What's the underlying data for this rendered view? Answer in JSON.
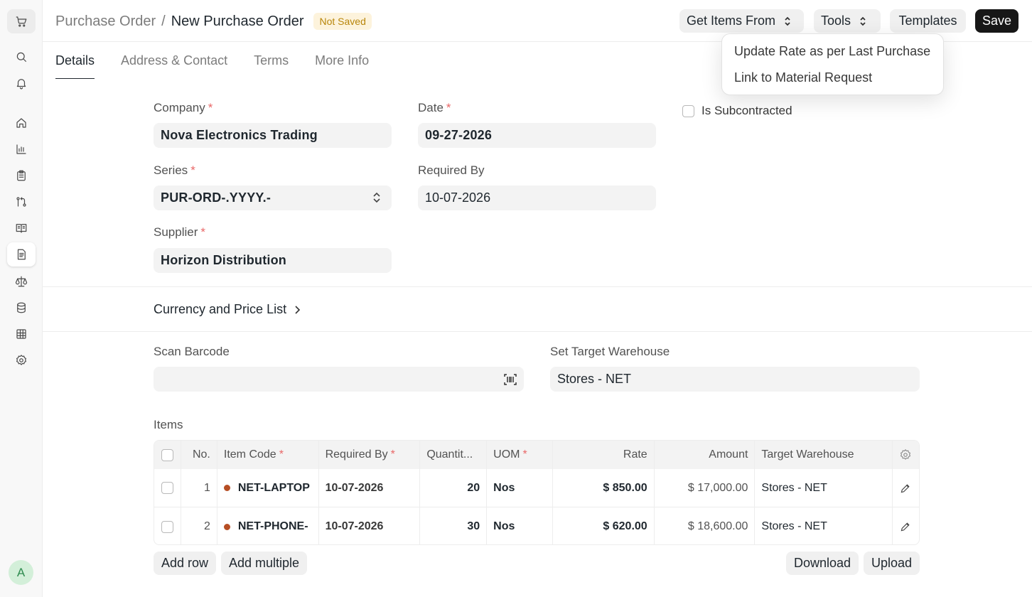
{
  "sidebar": {
    "icons": [
      "cart-icon",
      "search-icon",
      "bell-icon",
      "home-icon",
      "chart-icon",
      "clipboard-icon",
      "flow-icon",
      "book-icon",
      "document-icon",
      "scale-icon",
      "database-icon",
      "table-icon",
      "gear-icon"
    ],
    "avatar": "A"
  },
  "header": {
    "breadcrumb_parent": "Purchase Order",
    "breadcrumb_sep": "/",
    "title": "New Purchase Order",
    "status": "Not Saved",
    "get_items": "Get Items From",
    "tools": "Tools",
    "templates": "Templates",
    "save": "Save"
  },
  "tools_menu": {
    "items": [
      "Update Rate as per Last Purchase",
      "Link to Material Request"
    ]
  },
  "tabs": [
    "Details",
    "Address & Contact",
    "Terms",
    "More Info"
  ],
  "form": {
    "company_label": "Company",
    "company_value": "Nova Electronics Trading",
    "date_label": "Date",
    "date_value": "09-27-2026",
    "subcontracted_label": "Is Subcontracted",
    "series_label": "Series",
    "series_value": "PUR-ORD-.YYYY.-",
    "required_by_label": "Required By",
    "required_by_value": "10-07-2026",
    "supplier_label": "Supplier",
    "supplier_value": "Horizon Distribution",
    "required_mark": "*"
  },
  "currency_section": "Currency and Price List",
  "scan": {
    "barcode_label": "Scan Barcode",
    "barcode_value": "",
    "warehouse_label": "Set Target Warehouse",
    "warehouse_value": "Stores - NET"
  },
  "items": {
    "label": "Items",
    "columns": [
      "No.",
      "Item Code",
      "Required By",
      "Quantit...",
      "UOM",
      "Rate",
      "Amount",
      "Target Warehouse"
    ],
    "rows": [
      {
        "no": "1",
        "item_code": "NET-LAPTOP",
        "required_by": "10-07-2026",
        "qty": "20",
        "uom": "Nos",
        "rate": "$ 850.00",
        "amount": "$ 17,000.00",
        "warehouse": "Stores - NET"
      },
      {
        "no": "2",
        "item_code": "NET-PHONE-",
        "required_by": "10-07-2026",
        "qty": "30",
        "uom": "Nos",
        "rate": "$ 620.00",
        "amount": "$ 18,600.00",
        "warehouse": "Stores - NET"
      }
    ],
    "add_row": "Add row",
    "add_multiple": "Add multiple",
    "download": "Download",
    "upload": "Upload"
  }
}
